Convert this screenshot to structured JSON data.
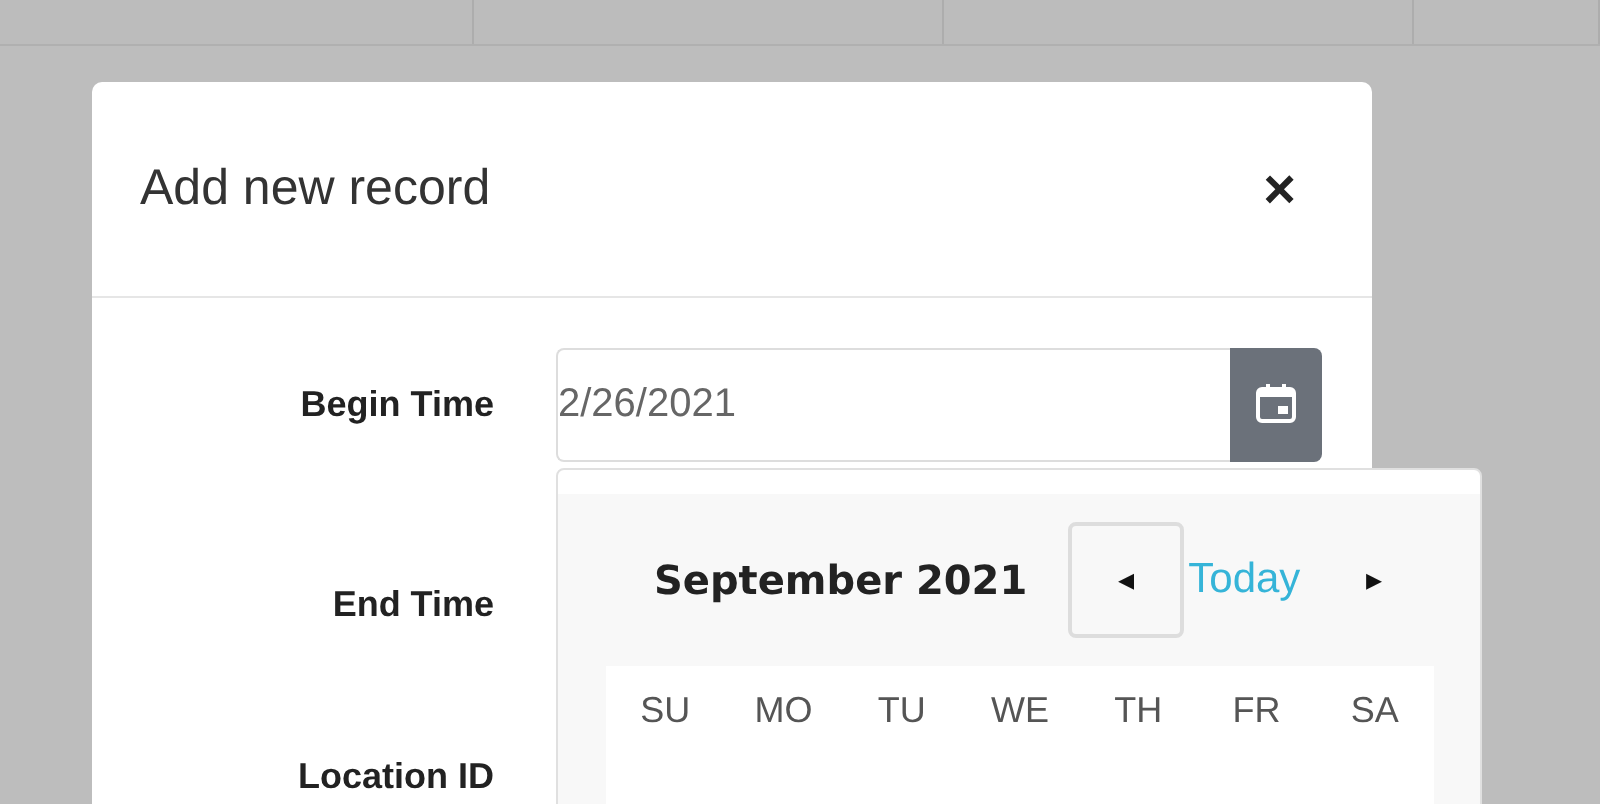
{
  "dialog": {
    "title": "Add new record",
    "close": "×",
    "fields": [
      {
        "label": "Begin Time",
        "value": "2/26/2021",
        "picker_open": true
      },
      {
        "label": "End Time"
      },
      {
        "label": "Location ID"
      }
    ]
  },
  "calendar": {
    "month": "September 2021",
    "today": "Today",
    "prev": "◂",
    "next": "▸",
    "weekdays": [
      "SU",
      "MO",
      "TU",
      "WE",
      "TH",
      "FR",
      "SA"
    ]
  }
}
